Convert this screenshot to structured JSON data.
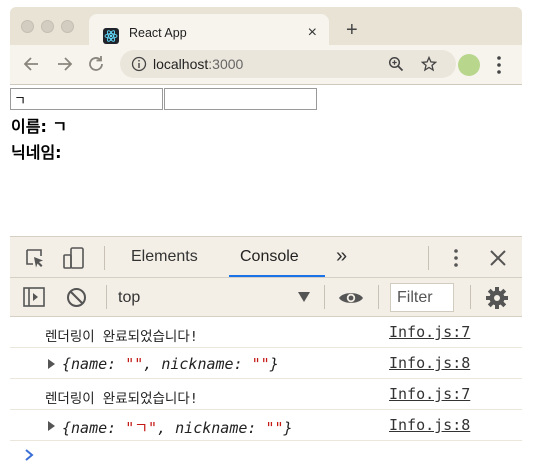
{
  "browser": {
    "tab_title": "React App",
    "tab_close": "×",
    "new_tab": "+",
    "url_host": "localhost",
    "url_port": ":3000"
  },
  "page": {
    "name_input_value": "ㄱ",
    "nickname_input_value": "",
    "name_label": "이름: ",
    "name_value": "ㄱ",
    "nickname_label": "닉네임: ",
    "nickname_value": ""
  },
  "devtools": {
    "tabs": [
      {
        "label": "Elements",
        "active": false
      },
      {
        "label": "Console",
        "active": true
      }
    ],
    "more_tabs": "»",
    "context": "top",
    "filter_placeholder": "Filter",
    "logs": [
      {
        "type": "text",
        "message": "렌더링이 완료되었습니다!",
        "source": "Info.js:7"
      },
      {
        "type": "object",
        "key1": "name",
        "val1": "\"\"",
        "key2": "nickname",
        "val2": "\"\"",
        "source": "Info.js:8"
      },
      {
        "type": "text",
        "message": "렌더링이 완료되었습니다!",
        "source": "Info.js:7"
      },
      {
        "type": "object",
        "key1": "name",
        "val1": "\"ㄱ\"",
        "key2": "nickname",
        "val2": "\"\"",
        "source": "Info.js:8"
      }
    ]
  },
  "colors": {
    "accent": "#1a73e8",
    "string_value": "#c41a16",
    "frame": "#e9e3d6"
  }
}
